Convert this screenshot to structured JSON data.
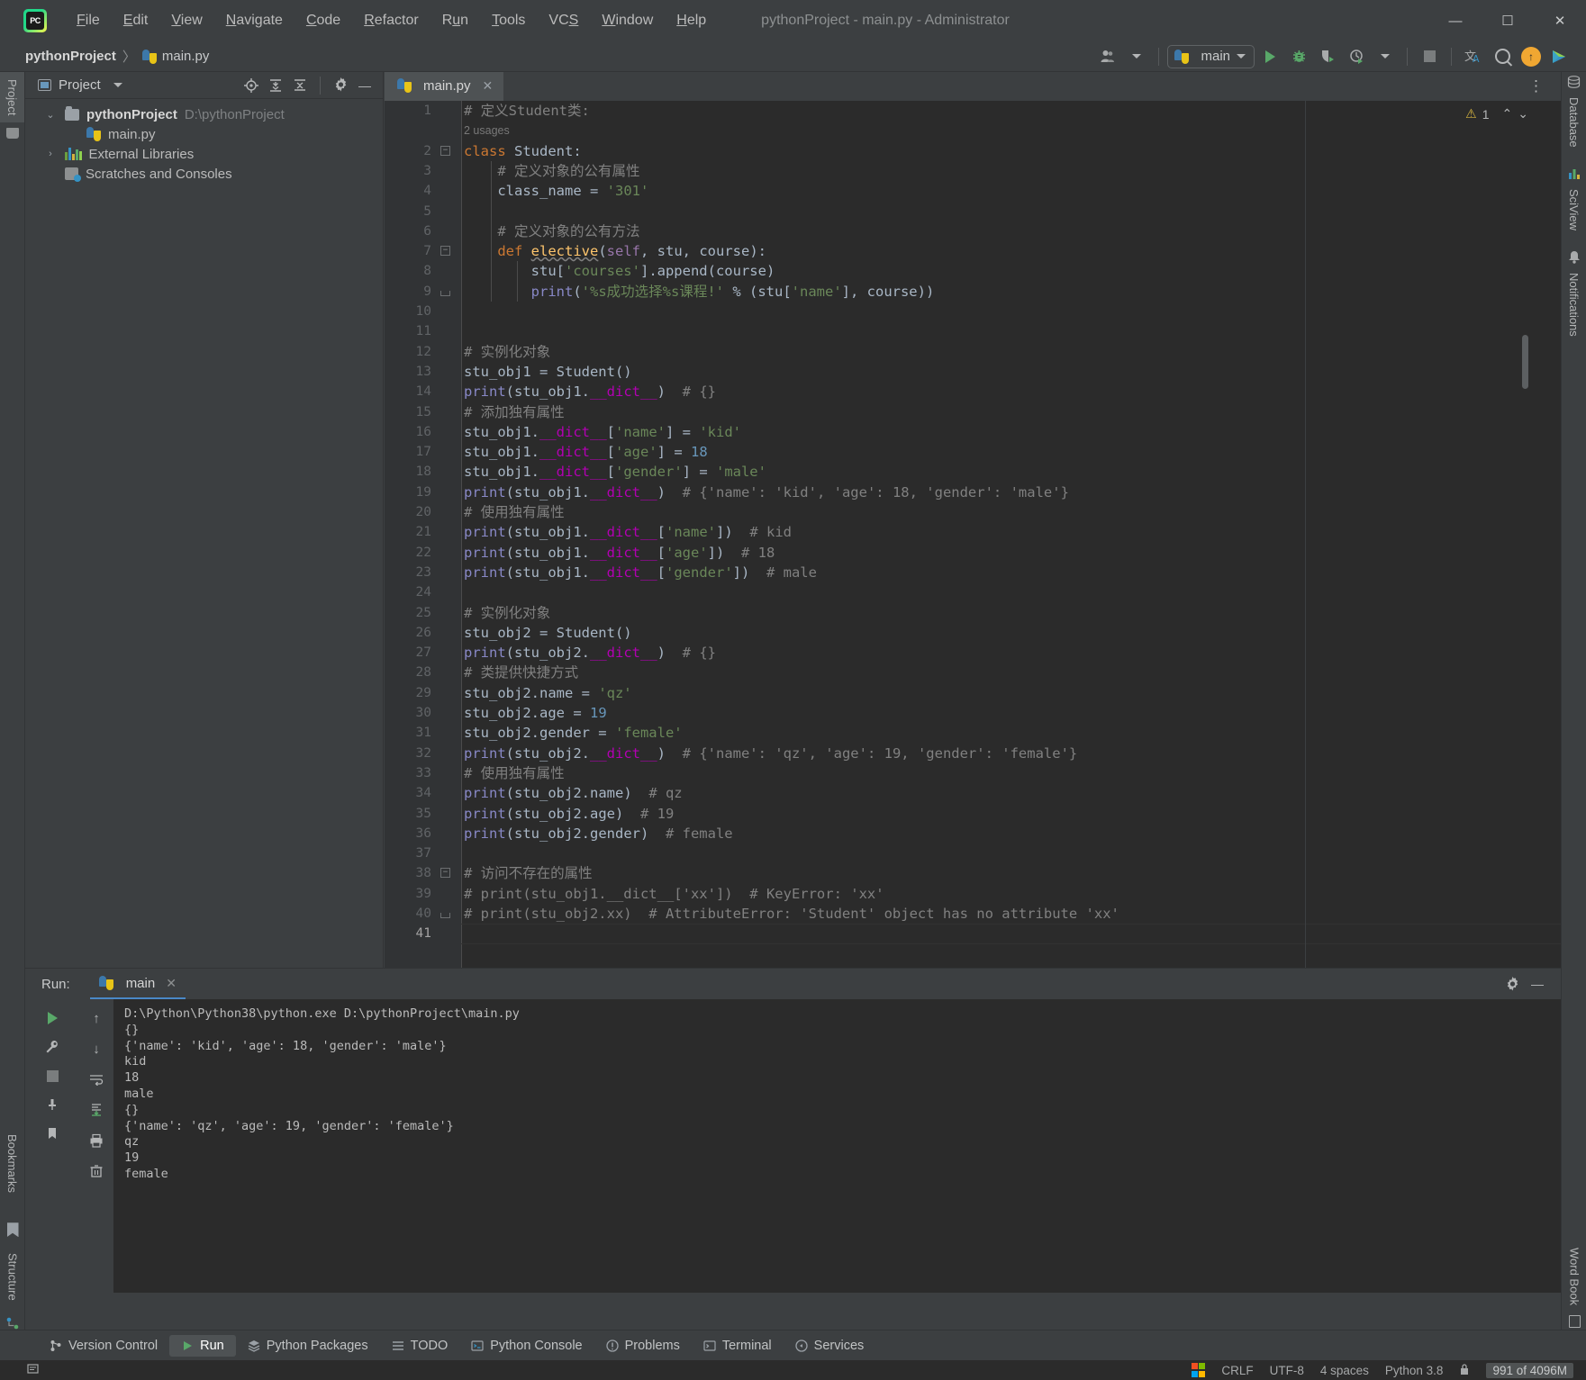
{
  "window": {
    "title": "pythonProject - main.py - Administrator",
    "app_icon": "pycharm-logo-icon",
    "minimize": "—",
    "maximize": "☐",
    "close": "✕"
  },
  "menubar": [
    {
      "label": "File",
      "mnemonic": "F"
    },
    {
      "label": "Edit",
      "mnemonic": "E"
    },
    {
      "label": "View",
      "mnemonic": "V"
    },
    {
      "label": "Navigate",
      "mnemonic": "N"
    },
    {
      "label": "Code",
      "mnemonic": "C"
    },
    {
      "label": "Refactor",
      "mnemonic": "R"
    },
    {
      "label": "Run",
      "mnemonic": "u"
    },
    {
      "label": "Tools",
      "mnemonic": "T"
    },
    {
      "label": "VCS",
      "mnemonic": "S"
    },
    {
      "label": "Window",
      "mnemonic": "W"
    },
    {
      "label": "Help",
      "mnemonic": "H"
    }
  ],
  "breadcrumb": {
    "project": "pythonProject",
    "separator": "〉",
    "file": "main.py",
    "file_icon": "python-file-icon"
  },
  "toolbar": {
    "run_config": "main",
    "run_config_icon": "python-file-icon",
    "icons": [
      "user-account-icon",
      "run-icon",
      "debug-icon",
      "coverage-icon",
      "profile-icon",
      "stop-icon",
      "translate-icon",
      "search-everywhere-icon",
      "update-available-icon",
      "ide-feature-icon"
    ]
  },
  "left_strips": {
    "top": [
      {
        "label": "Project",
        "selected": true
      }
    ],
    "bottom": [
      {
        "label": "Bookmarks"
      },
      {
        "label": "Structure"
      }
    ]
  },
  "right_strips": [
    {
      "label": "Database",
      "icon": "database-icon"
    },
    {
      "label": "SciView",
      "icon": "sciview-icon"
    },
    {
      "label": "Notifications",
      "icon": "bell-icon"
    },
    {
      "label": "Word Book",
      "icon": "book-icon"
    }
  ],
  "project_panel": {
    "title": "Project",
    "tools": [
      "target-icon",
      "expand-all-icon",
      "collapse-all-icon",
      "gear-icon",
      "hide-icon"
    ],
    "tree": [
      {
        "label": "pythonProject",
        "path": "D:\\pythonProject",
        "icon": "folder-icon",
        "arrow": "⌄",
        "depth": 1,
        "bold": true
      },
      {
        "label": "main.py",
        "path": "",
        "icon": "python-file-icon",
        "arrow": "",
        "depth": 2,
        "bold": false
      },
      {
        "label": "External Libraries",
        "path": "",
        "icon": "libraries-icon",
        "arrow": "›",
        "depth": 1,
        "bold": false
      },
      {
        "label": "Scratches and Consoles",
        "path": "",
        "icon": "scratches-icon",
        "arrow": "",
        "depth": 1,
        "bold": false
      }
    ]
  },
  "editor": {
    "tab": {
      "label": "main.py",
      "icon": "python-file-icon",
      "close": "✕"
    },
    "options_icon": "more-options-icon",
    "inspection": {
      "warning_count": "1",
      "warning_icon": "warning-triangle-icon",
      "up": "⌃",
      "down": "⌄"
    },
    "total_lines": 41,
    "usages_hint": {
      "line": 1,
      "text": "2 usages"
    },
    "lines": [
      {
        "n": 1,
        "tokens": [
          {
            "t": "# 定义Student类:",
            "c": "c"
          }
        ]
      },
      {
        "n": 2,
        "fold": "minus",
        "tokens": [
          {
            "t": "class",
            "c": "k"
          },
          {
            "t": " Student:",
            "c": "b"
          }
        ]
      },
      {
        "n": 3,
        "tokens": [
          {
            "t": "    # 定义对象的公有属性",
            "c": "c"
          }
        ]
      },
      {
        "n": 4,
        "tokens": [
          {
            "t": "    class_name ",
            "c": "b"
          },
          {
            "t": "=",
            "c": "b"
          },
          {
            "t": " ",
            "c": "b"
          },
          {
            "t": "'301'",
            "c": "s"
          }
        ]
      },
      {
        "n": 5,
        "tokens": []
      },
      {
        "n": 6,
        "tokens": [
          {
            "t": "    # 定义对象的公有方法",
            "c": "c"
          }
        ]
      },
      {
        "n": 7,
        "fold": "minus",
        "tokens": [
          {
            "t": "    ",
            "c": "b"
          },
          {
            "t": "def",
            "c": "k"
          },
          {
            "t": " ",
            "c": "b"
          },
          {
            "t": "elective",
            "c": "fn wavy"
          },
          {
            "t": "(",
            "c": "b"
          },
          {
            "t": "self",
            "c": "sp"
          },
          {
            "t": ", stu, course):",
            "c": "b"
          }
        ]
      },
      {
        "n": 8,
        "tokens": [
          {
            "t": "        stu[",
            "c": "b"
          },
          {
            "t": "'courses'",
            "c": "s"
          },
          {
            "t": "].append(course)",
            "c": "b"
          }
        ]
      },
      {
        "n": 9,
        "fold": "end",
        "tokens": [
          {
            "t": "        ",
            "c": "b"
          },
          {
            "t": "print",
            "c": "bi"
          },
          {
            "t": "(",
            "c": "b"
          },
          {
            "t": "'%s成功选择%s课程!'",
            "c": "s"
          },
          {
            "t": " % (stu[",
            "c": "b"
          },
          {
            "t": "'name'",
            "c": "s"
          },
          {
            "t": "], course))",
            "c": "b"
          }
        ]
      },
      {
        "n": 10,
        "tokens": []
      },
      {
        "n": 11,
        "tokens": []
      },
      {
        "n": 12,
        "tokens": [
          {
            "t": "# 实例化对象",
            "c": "c"
          }
        ]
      },
      {
        "n": 13,
        "tokens": [
          {
            "t": "stu_obj1 = Student()",
            "c": "b"
          }
        ]
      },
      {
        "n": 14,
        "tokens": [
          {
            "t": "print",
            "c": "bi"
          },
          {
            "t": "(stu_obj1.",
            "c": "b"
          },
          {
            "t": "__dict__",
            "c": "mag"
          },
          {
            "t": ")  ",
            "c": "b"
          },
          {
            "t": "# {}",
            "c": "c"
          }
        ]
      },
      {
        "n": 15,
        "tokens": [
          {
            "t": "# 添加独有属性",
            "c": "c"
          }
        ]
      },
      {
        "n": 16,
        "tokens": [
          {
            "t": "stu_obj1.",
            "c": "b"
          },
          {
            "t": "__dict__",
            "c": "mag"
          },
          {
            "t": "[",
            "c": "b"
          },
          {
            "t": "'name'",
            "c": "s"
          },
          {
            "t": "] = ",
            "c": "b"
          },
          {
            "t": "'kid'",
            "c": "s"
          }
        ]
      },
      {
        "n": 17,
        "tokens": [
          {
            "t": "stu_obj1.",
            "c": "b"
          },
          {
            "t": "__dict__",
            "c": "mag"
          },
          {
            "t": "[",
            "c": "b"
          },
          {
            "t": "'age'",
            "c": "s"
          },
          {
            "t": "] = ",
            "c": "b"
          },
          {
            "t": "18",
            "c": "n"
          }
        ]
      },
      {
        "n": 18,
        "tokens": [
          {
            "t": "stu_obj1.",
            "c": "b"
          },
          {
            "t": "__dict__",
            "c": "mag"
          },
          {
            "t": "[",
            "c": "b"
          },
          {
            "t": "'gender'",
            "c": "s"
          },
          {
            "t": "] = ",
            "c": "b"
          },
          {
            "t": "'male'",
            "c": "s"
          }
        ]
      },
      {
        "n": 19,
        "tokens": [
          {
            "t": "print",
            "c": "bi"
          },
          {
            "t": "(stu_obj1.",
            "c": "b"
          },
          {
            "t": "__dict__",
            "c": "mag"
          },
          {
            "t": ")  ",
            "c": "b"
          },
          {
            "t": "# {'name': 'kid', 'age': 18, 'gender': 'male'}",
            "c": "c"
          }
        ]
      },
      {
        "n": 20,
        "tokens": [
          {
            "t": "# 使用独有属性",
            "c": "c"
          }
        ]
      },
      {
        "n": 21,
        "tokens": [
          {
            "t": "print",
            "c": "bi"
          },
          {
            "t": "(stu_obj1.",
            "c": "b"
          },
          {
            "t": "__dict__",
            "c": "mag"
          },
          {
            "t": "[",
            "c": "b"
          },
          {
            "t": "'name'",
            "c": "s"
          },
          {
            "t": "])  ",
            "c": "b"
          },
          {
            "t": "# kid",
            "c": "c"
          }
        ]
      },
      {
        "n": 22,
        "tokens": [
          {
            "t": "print",
            "c": "bi"
          },
          {
            "t": "(stu_obj1.",
            "c": "b"
          },
          {
            "t": "__dict__",
            "c": "mag"
          },
          {
            "t": "[",
            "c": "b"
          },
          {
            "t": "'age'",
            "c": "s"
          },
          {
            "t": "])  ",
            "c": "b"
          },
          {
            "t": "# 18",
            "c": "c"
          }
        ]
      },
      {
        "n": 23,
        "tokens": [
          {
            "t": "print",
            "c": "bi"
          },
          {
            "t": "(stu_obj1.",
            "c": "b"
          },
          {
            "t": "__dict__",
            "c": "mag"
          },
          {
            "t": "[",
            "c": "b"
          },
          {
            "t": "'gender'",
            "c": "s"
          },
          {
            "t": "])  ",
            "c": "b"
          },
          {
            "t": "# male",
            "c": "c"
          }
        ]
      },
      {
        "n": 24,
        "tokens": []
      },
      {
        "n": 25,
        "tokens": [
          {
            "t": "# 实例化对象",
            "c": "c"
          }
        ]
      },
      {
        "n": 26,
        "tokens": [
          {
            "t": "stu_obj2 = Student()",
            "c": "b"
          }
        ]
      },
      {
        "n": 27,
        "tokens": [
          {
            "t": "print",
            "c": "bi"
          },
          {
            "t": "(stu_obj2.",
            "c": "b"
          },
          {
            "t": "__dict__",
            "c": "mag"
          },
          {
            "t": ")  ",
            "c": "b"
          },
          {
            "t": "# {}",
            "c": "c"
          }
        ]
      },
      {
        "n": 28,
        "tokens": [
          {
            "t": "# 类提供快捷方式",
            "c": "c"
          }
        ]
      },
      {
        "n": 29,
        "tokens": [
          {
            "t": "stu_obj2.name = ",
            "c": "b"
          },
          {
            "t": "'qz'",
            "c": "s"
          }
        ]
      },
      {
        "n": 30,
        "tokens": [
          {
            "t": "stu_obj2.age = ",
            "c": "b"
          },
          {
            "t": "19",
            "c": "n"
          }
        ]
      },
      {
        "n": 31,
        "tokens": [
          {
            "t": "stu_obj2.gender = ",
            "c": "b"
          },
          {
            "t": "'female'",
            "c": "s"
          }
        ]
      },
      {
        "n": 32,
        "tokens": [
          {
            "t": "print",
            "c": "bi"
          },
          {
            "t": "(stu_obj2.",
            "c": "b"
          },
          {
            "t": "__dict__",
            "c": "mag"
          },
          {
            "t": ")  ",
            "c": "b"
          },
          {
            "t": "# {'name': 'qz', 'age': 19, 'gender': 'female'}",
            "c": "c"
          }
        ]
      },
      {
        "n": 33,
        "tokens": [
          {
            "t": "# 使用独有属性",
            "c": "c"
          }
        ]
      },
      {
        "n": 34,
        "tokens": [
          {
            "t": "print",
            "c": "bi"
          },
          {
            "t": "(stu_obj2.name)  ",
            "c": "b"
          },
          {
            "t": "# qz",
            "c": "c"
          }
        ]
      },
      {
        "n": 35,
        "tokens": [
          {
            "t": "print",
            "c": "bi"
          },
          {
            "t": "(stu_obj2.age)  ",
            "c": "b"
          },
          {
            "t": "# 19",
            "c": "c"
          }
        ]
      },
      {
        "n": 36,
        "tokens": [
          {
            "t": "print",
            "c": "bi"
          },
          {
            "t": "(stu_obj2.gender)  ",
            "c": "b"
          },
          {
            "t": "# female",
            "c": "c"
          }
        ]
      },
      {
        "n": 37,
        "tokens": []
      },
      {
        "n": 38,
        "fold": "minus",
        "tokens": [
          {
            "t": "# 访问不存在的属性",
            "c": "c"
          }
        ]
      },
      {
        "n": 39,
        "tokens": [
          {
            "t": "# print(stu_obj1.__dict__['xx'])  # KeyError: 'xx'",
            "c": "c"
          }
        ]
      },
      {
        "n": 40,
        "fold": "end",
        "tokens": [
          {
            "t": "# print(stu_obj2.xx)  # AttributeError: 'Student' object has no attribute 'xx'",
            "c": "c"
          }
        ]
      },
      {
        "n": 41,
        "current": true,
        "tokens": []
      }
    ]
  },
  "run_panel": {
    "label": "Run:",
    "tab": {
      "label": "main",
      "icon": "python-file-icon",
      "close": "✕"
    },
    "head_icons": [
      "gear-icon",
      "hide-icon"
    ],
    "tools_left": [
      "rerun-icon",
      "settings-wrench-icon",
      "stop-icon",
      "pin-icon",
      "bookmark-icon"
    ],
    "tools_right": [
      "scroll-up-icon",
      "scroll-down-icon",
      "soft-wrap-icon",
      "scroll-to-end-icon",
      "print-icon",
      "clear-all-icon"
    ],
    "console": [
      "D:\\Python\\Python38\\python.exe D:\\pythonProject\\main.py",
      "{}",
      "{'name': 'kid', 'age': 18, 'gender': 'male'}",
      "kid",
      "18",
      "male",
      "{}",
      "{'name': 'qz', 'age': 19, 'gender': 'female'}",
      "qz",
      "19",
      "female"
    ]
  },
  "tool_window_bar": [
    {
      "label": "Version Control",
      "icon": "branch-icon",
      "selected": false
    },
    {
      "label": "Run",
      "icon": "run-icon",
      "selected": true
    },
    {
      "label": "Python Packages",
      "icon": "packages-icon",
      "selected": false
    },
    {
      "label": "TODO",
      "icon": "todo-icon",
      "selected": false
    },
    {
      "label": "Python Console",
      "icon": "console-icon",
      "selected": false
    },
    {
      "label": "Problems",
      "icon": "problems-icon",
      "selected": false
    },
    {
      "label": "Terminal",
      "icon": "terminal-icon",
      "selected": false
    },
    {
      "label": "Services",
      "icon": "services-icon",
      "selected": false
    }
  ],
  "status_bar": {
    "left_icon": "event-log-icon",
    "os_logo": "windows-logo-icon",
    "line_sep": "CRLF",
    "encoding": "UTF-8",
    "indent": "4 spaces",
    "interpreter": "Python 3.8",
    "lock_icon": "lock-icon",
    "memory": "991 of 4096M"
  },
  "colors": {
    "accent_blue": "#4a88c7",
    "run_green": "#59a869",
    "warning_yellow": "#d4b33f",
    "magic_magenta": "#b200b2",
    "string_green": "#6a8759",
    "keyword_orange": "#cc7832",
    "number_blue": "#6897bb",
    "comment_gray": "#808080",
    "bg_editor": "#2b2b2b",
    "bg_chrome": "#3c3f41"
  }
}
